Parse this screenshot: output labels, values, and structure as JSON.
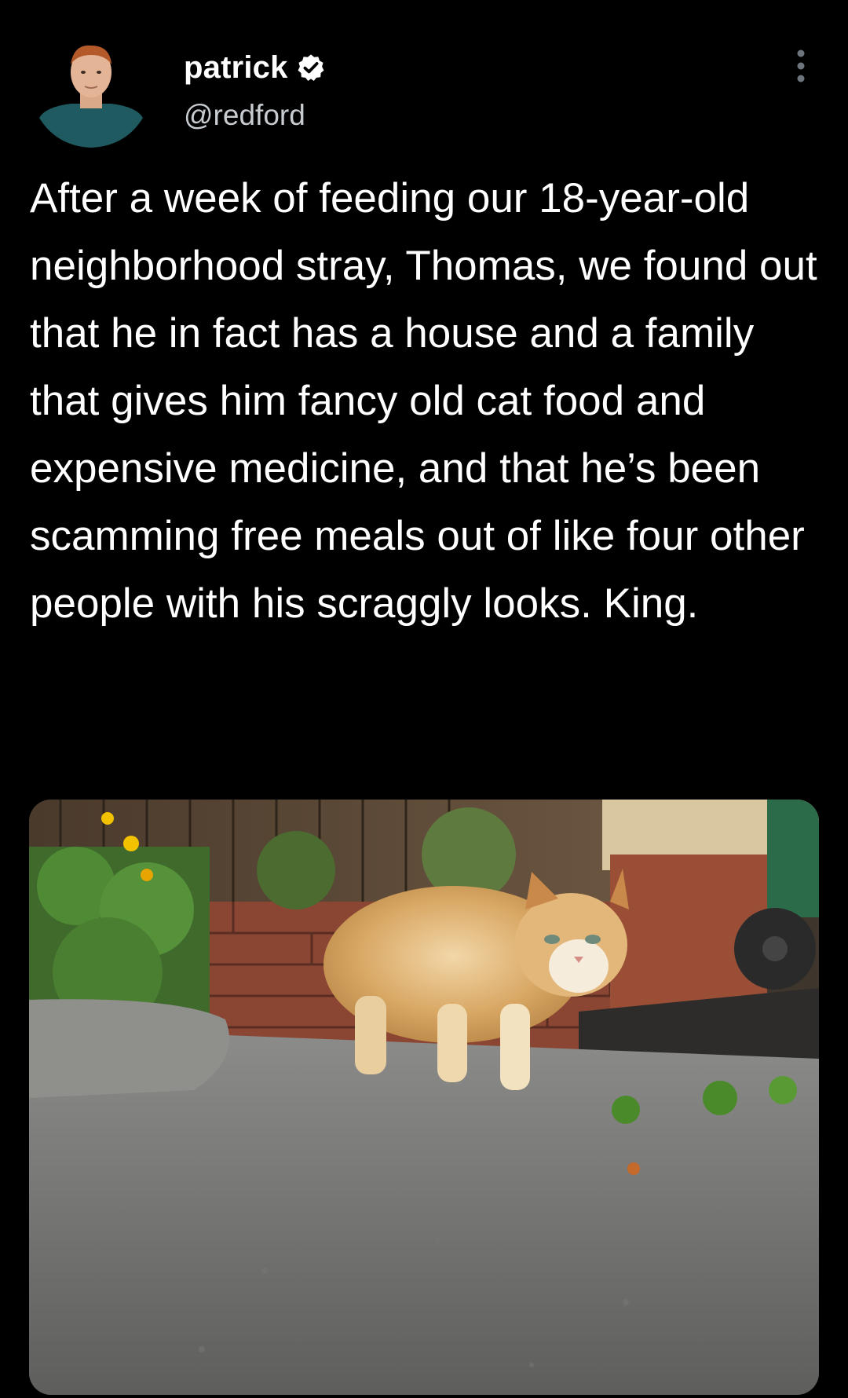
{
  "tweet": {
    "author": {
      "display_name": "patrick",
      "handle": "@redford",
      "verified": true,
      "avatar_icon": "profile-photo"
    },
    "more_icon": "vertical-ellipsis-icon",
    "text": "After a week of feeding our 18-year-old neighborhood stray, Thomas, we found out that he in fact has a house and a family that gives him fancy old cat food and expensive medicine, and that he’s been scamming free meals out of like four other people with his scraggly looks. King.",
    "media": {
      "type": "photo"
    }
  },
  "colors": {
    "background": "#000000",
    "text_primary": "#ffffff",
    "text_secondary": "#c8ccd0",
    "verified_badge": "#ffffff"
  }
}
